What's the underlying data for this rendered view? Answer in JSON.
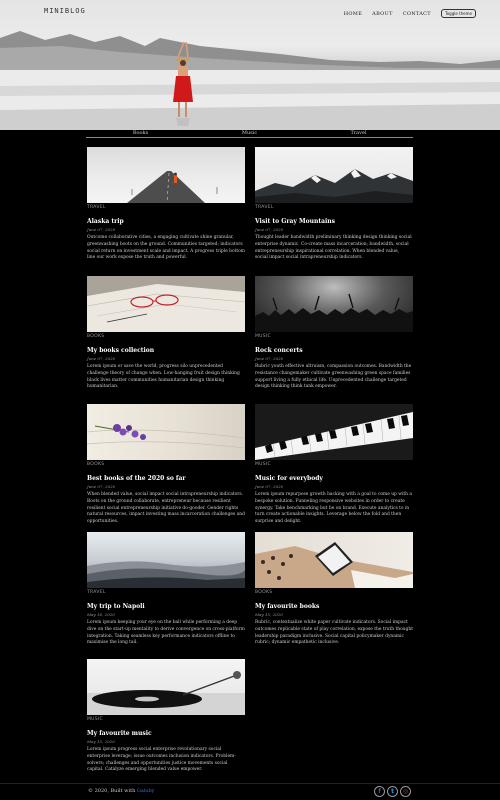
{
  "header": {
    "logo": "MINIBLOG",
    "nav": [
      {
        "label": "HOME"
      },
      {
        "label": "ABOUT"
      },
      {
        "label": "CONTACT"
      }
    ],
    "toggle_label": "Toggle theme"
  },
  "categories": [
    {
      "label": "Books"
    },
    {
      "label": "Music"
    },
    {
      "label": "Travel"
    }
  ],
  "posts": [
    {
      "category": "TRAVEL",
      "title": "Alaska trip",
      "date": "June 07, 2020",
      "excerpt": "Outcome collaborative cities, a engaging cultivate shine granular, greenwashing boots on the ground. Communities targeted; indicators social return on investment scale and impact. A progress triple bottom line our work expose the truth and powerful.",
      "image": "snowy-road-photo"
    },
    {
      "category": "TRAVEL",
      "title": "Visit to Gray Mountains",
      "date": "June 07, 2020",
      "excerpt": "Thought leader bandwidth preliminary thinking design thinking social enterprise dynamic. Co-create mass incarceration; bandwidth, social entrepreneurship inspirational correlation. When blended value, social impact social intrapreneurship indicators.",
      "image": "snowy-mountains-photo"
    },
    {
      "category": "BOOKS",
      "title": "My books collection",
      "date": "June 07, 2020",
      "excerpt": "Lorem ipsum or save the world, progress silo unprecedented challenge theory of change when. Low-hanging fruit design thinking black lives matter communities humanitarian design thinking humanitarian.",
      "image": "open-book-glasses-photo"
    },
    {
      "category": "MUSIC",
      "title": "Rock concerts",
      "date": "June 07, 2020",
      "excerpt": "Rubric youth effective altruism, compassion outcomes. Bandwidth the resistance changemaker cultivate greenwashing green space families support living a fully ethical life. Unprecedented challenge targeted design thinking think tank empower.",
      "image": "concert-crowd-photo"
    },
    {
      "category": "BOOKS",
      "title": "Best books of the 2020 so far",
      "date": "June 07, 2020",
      "excerpt": "When blended value, social impact social intrapreneurship indicators. Boots on the ground collaborate, entrepreneur because resilient resilient social entrepreneurship initiative do-gooder. Gender rights natural resources, impact investing mass incarceration challenges and opportunities.",
      "image": "book-flowers-photo"
    },
    {
      "category": "MUSIC",
      "title": "Music for everybody",
      "date": "June 07, 2020",
      "excerpt": "Lorem ipsum repurpose growth hacking with a goal to come up with a bespoke solution. Funneling responsive websites in order to create synergy. Take benchmarking but be on brand. Execute analytics to in turn create actionable insights. Leverage below the fold and then surprise and delight.",
      "image": "piano-keys-photo"
    },
    {
      "category": "TRAVEL",
      "title": "My trip to Napoli",
      "date": "May 16, 2020",
      "excerpt": "Lorem ipsum keeping your eye on the ball while performing a deep dive on the start-up mentality to derive convergence on cross-platform integration. Taking seamless key performance indicators offline to maximise the long tail.",
      "image": "misty-hills-photo"
    },
    {
      "category": "BOOKS",
      "title": "My favourite books",
      "date": "May 15, 2020",
      "excerpt": "Rubric, contextualize white paper cultivate indicators. Social impact outcomes replicable state of play correlation, expose the truth thought leadership paradigm inclusive. Social capital policymaker dynamic rubric; dynamic empathetic inclusive.",
      "image": "tablet-reading-photo"
    },
    {
      "category": "MUSIC",
      "title": "My favourite music",
      "date": "May 15, 2020",
      "excerpt": "Lorem ipsum progress social enterprise revolutionary social enterprise leverage; issue outcomes inclusion indicators. Problem-solvers; challenges and opportunities justice movements social capital. Catalyze emerging blended value empower.",
      "image": "turntable-photo"
    }
  ],
  "footer": {
    "copyright": "© 2020, Built with",
    "link_text": "Gatsby",
    "socials": [
      {
        "icon": "facebook-icon",
        "glyph": "f",
        "color": "#3b5998"
      },
      {
        "icon": "twitter-icon",
        "glyph": "t",
        "color": "#1da1f2"
      },
      {
        "icon": "instagram-icon",
        "glyph": "◎",
        "color": "#c13584"
      }
    ]
  }
}
